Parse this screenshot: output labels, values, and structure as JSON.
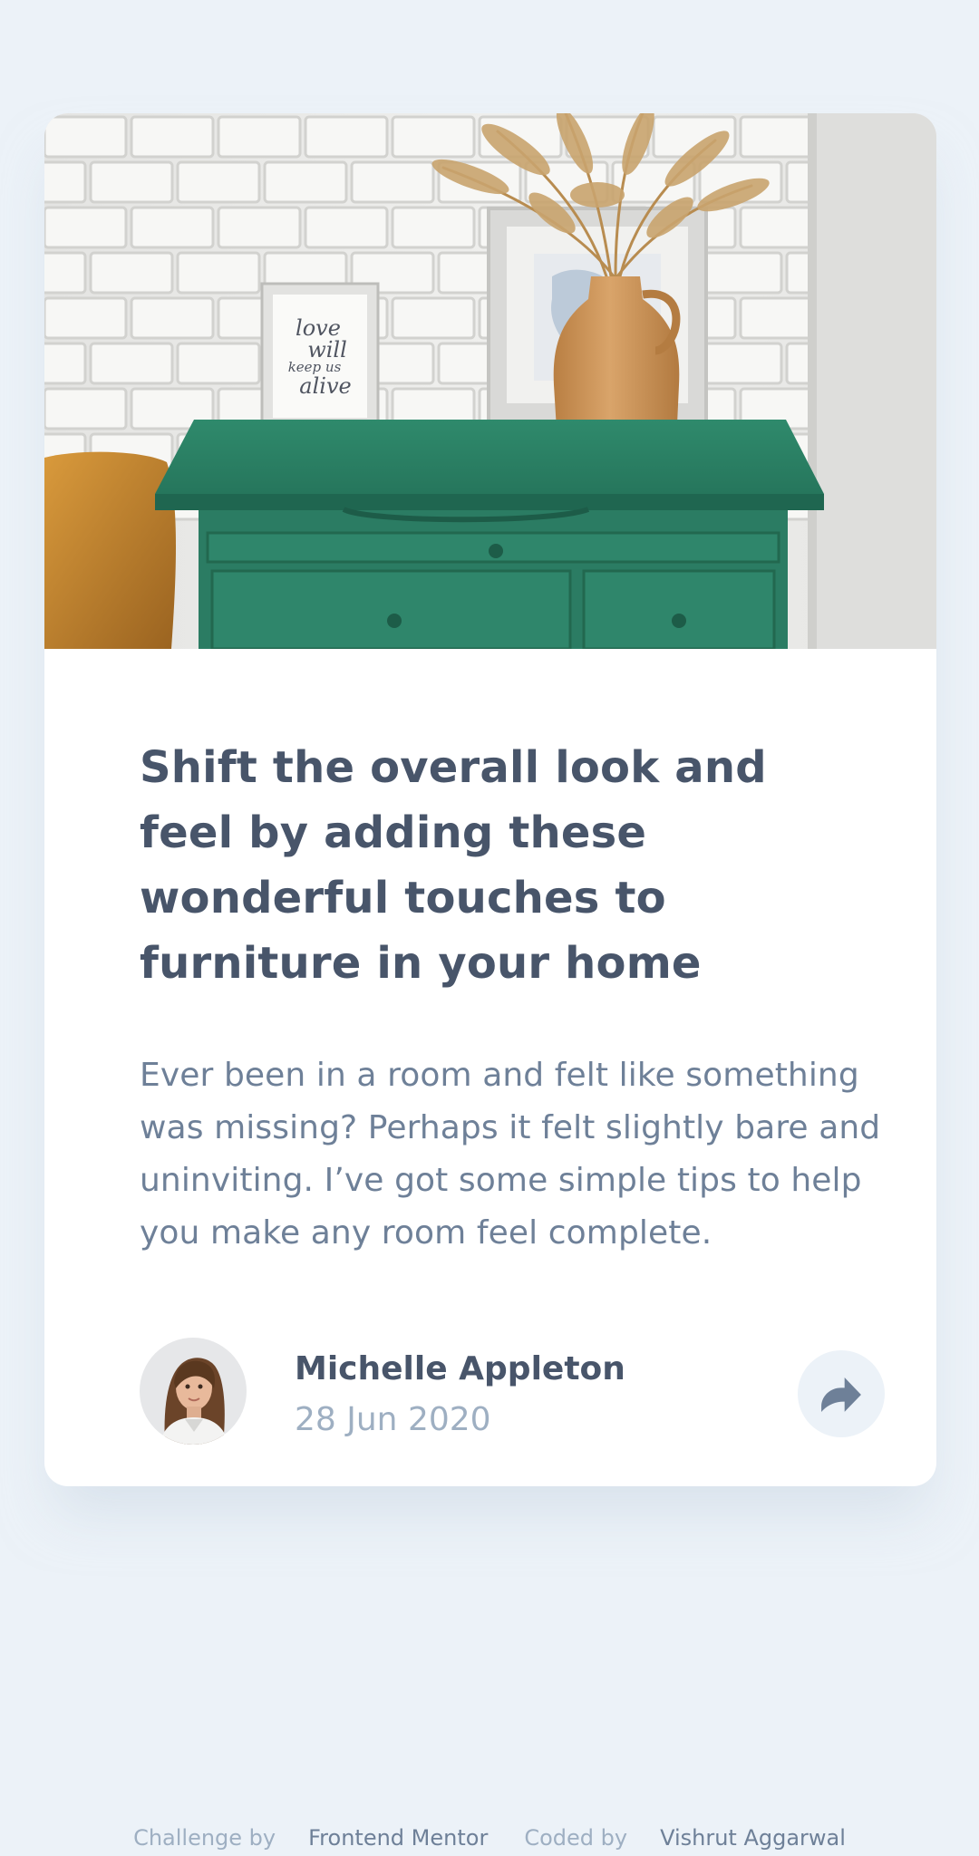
{
  "article": {
    "headline": "Shift the overall look and feel by adding these wonderful touches to furniture in your home",
    "excerpt": "Ever been in a room and felt like something was missing? Perhaps it felt slightly bare and uninviting. I’ve got some simple tips to help you make any room feel complete.",
    "hero_frame_text": [
      "love",
      "will",
      "keep us",
      "alive"
    ]
  },
  "author": {
    "name": "Michelle Appleton",
    "date": "28 Jun 2020"
  },
  "share": {
    "icon": "share-icon"
  },
  "attribution": {
    "challenge_label": "Challenge by",
    "challenge_link": "Frontend Mentor",
    "coded_label": "Coded by",
    "coded_link": "Vishrut Aggarwal"
  },
  "colors": {
    "page_background": "#ecf2f8",
    "card_background": "#ffffff",
    "heading": "#48556a",
    "body_text": "#6e8098",
    "muted_text": "#9eafc2",
    "drawer_green": "#2b7c63"
  }
}
